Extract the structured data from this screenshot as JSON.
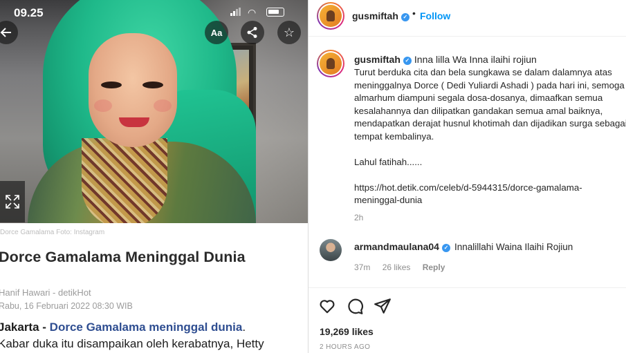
{
  "article": {
    "status_time": "09.25",
    "aa_label": "Aa",
    "caption": "Dorce Gamalama Foto: Instagram",
    "headline": "Dorce Gamalama Meninggal Dunia",
    "author": "Hanif Hawari - detikHot",
    "date": "Rabu, 16 Februari 2022 08:30 WIB",
    "lede_place": "Jakarta - ",
    "lede_link": "Dorce Gamalama meninggal dunia",
    "lede_after": ".",
    "lede_line2": "Kabar duka itu disampaikan oleh kerabatnya, Hetty"
  },
  "post": {
    "username": "gusmiftah",
    "follow_label": "Follow",
    "separator": "•",
    "caption_lead": "Inna lilla Wa Inna ilaihi rojiun",
    "caption_body": "Turut berduka cita dan bela sungkawa se dalam dalamnya atas\nmeninggalnya Dorce ( Dedi Yuliardi Ashadi ) pada hari ini, semoga\nalmarhum diampuni segala dosa-dosanya, dimaafkan semua\nkesalahannya dan dilipatkan gandakan semua amal baiknya,\nmendapatkan derajat husnul khotimah dan dijadikan surga sebagai\ntempat kembalinya.\n\nLahul fatihah......\n\nhttps://hot.detik.com/celeb/d-5944315/dorce-gamalama-\nmeninggal-dunia",
    "caption_time": "2h",
    "likes": "19,269 likes",
    "posted": "2 HOURS AGO"
  },
  "comment": {
    "username": "armandmaulana04",
    "text": "Innalillahi Waina Ilaihi Rojiun",
    "time": "37m",
    "likes": "26 likes",
    "reply": "Reply"
  },
  "icons": [
    "back-arrow-icon",
    "text-size-icon",
    "share-icon",
    "star-icon",
    "expand-icon",
    "verified-badge-icon",
    "heart-icon",
    "comment-icon",
    "send-icon"
  ]
}
